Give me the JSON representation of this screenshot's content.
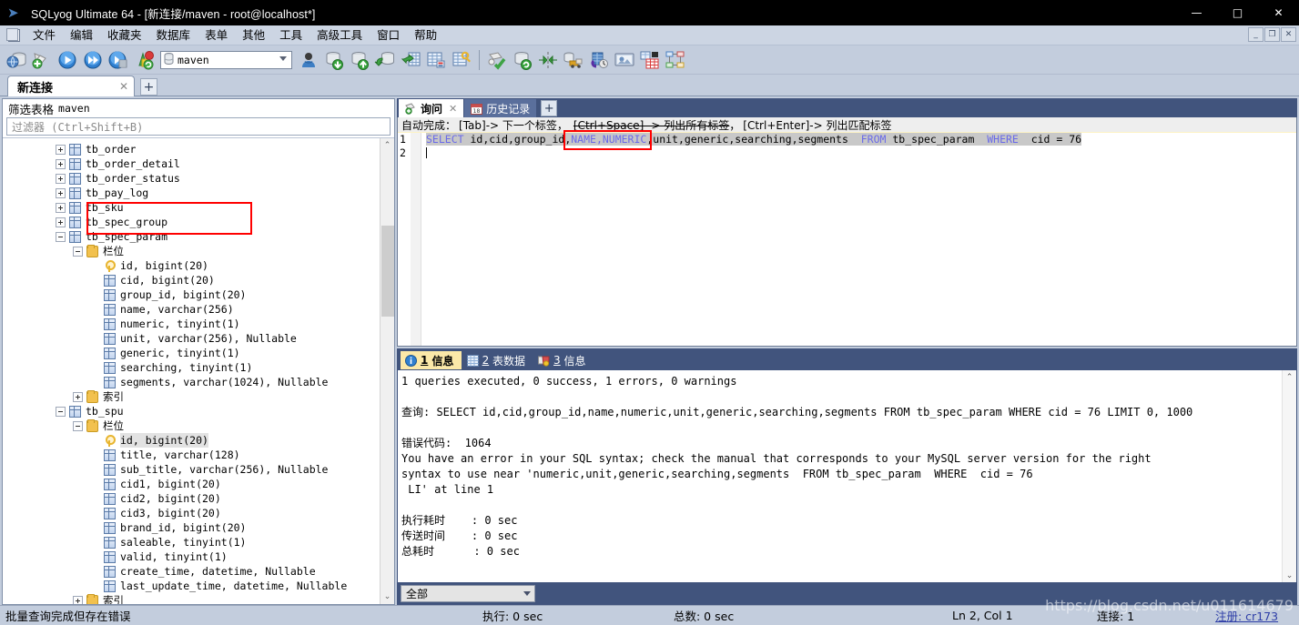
{
  "window": {
    "title": "SQLyog Ultimate 64 - [新连接/maven - root@localhost*]",
    "app_icon": "sqlyog-dolphin-icon",
    "minimize": "—",
    "maximize": "□",
    "close": "✕",
    "mdi_minimize": "_",
    "mdi_restore": "❐",
    "mdi_close": "✕"
  },
  "menu": {
    "items": [
      {
        "label": "文件"
      },
      {
        "label": "编辑"
      },
      {
        "label": "收藏夹"
      },
      {
        "label": "数据库"
      },
      {
        "label": "表单"
      },
      {
        "label": "其他"
      },
      {
        "label": "工具"
      },
      {
        "label": "高级工具"
      },
      {
        "label": "窗口"
      },
      {
        "label": "帮助"
      }
    ]
  },
  "toolbar": {
    "database_selector_value": "maven",
    "buttons": [
      {
        "name": "new-connection-icon"
      },
      {
        "name": "new-query-tab-icon"
      },
      {
        "name": "execute-query-icon"
      },
      {
        "name": "execute-all-queries-icon"
      },
      {
        "name": "stop-query-icon"
      },
      {
        "name": "refresh-objects-icon"
      },
      {
        "name": "user-manager-icon"
      },
      {
        "name": "import-database-icon"
      },
      {
        "name": "export-database-icon"
      },
      {
        "name": "backup-database-icon"
      },
      {
        "name": "restore-table-icon"
      },
      {
        "name": "create-table-icon"
      },
      {
        "name": "manage-index-icon"
      },
      {
        "name": "query-builder-icon"
      },
      {
        "name": "sync-database-icon"
      },
      {
        "name": "data-compare-icon"
      },
      {
        "name": "schema-migration-icon"
      },
      {
        "name": "scheduled-backup-icon"
      },
      {
        "name": "notifications-icon"
      },
      {
        "name": "grid-view-icon"
      },
      {
        "name": "er-diagram-icon"
      }
    ]
  },
  "connection_tabs": {
    "tabs": [
      {
        "label": "新连接",
        "close": "✕",
        "active": true
      }
    ],
    "add_label": "+"
  },
  "object_browser": {
    "filter_title": "筛选表格",
    "filter_database": "maven",
    "filter_placeholder": "过滤器 (Ctrl+Shift+B)",
    "tree": [
      {
        "indent": 1,
        "expander": "plus",
        "icon": "table-icon",
        "label": "tb_order"
      },
      {
        "indent": 1,
        "expander": "plus",
        "icon": "table-icon",
        "label": "tb_order_detail"
      },
      {
        "indent": 1,
        "expander": "plus",
        "icon": "table-icon",
        "label": "tb_order_status"
      },
      {
        "indent": 1,
        "expander": "plus",
        "icon": "table-icon",
        "label": "tb_pay_log"
      },
      {
        "indent": 1,
        "expander": "plus",
        "icon": "table-icon",
        "label": "tb_sku"
      },
      {
        "indent": 1,
        "expander": "plus",
        "icon": "table-icon",
        "label": "tb_spec_group"
      },
      {
        "indent": 1,
        "expander": "minus",
        "icon": "table-icon",
        "label": "tb_spec_param"
      },
      {
        "indent": 2,
        "expander": "minus",
        "icon": "folder-icon",
        "label": "栏位"
      },
      {
        "indent": 3,
        "expander": "none",
        "icon": "key-icon",
        "label": "id, bigint(20)"
      },
      {
        "indent": 3,
        "expander": "none",
        "icon": "column-icon",
        "label": "cid, bigint(20)"
      },
      {
        "indent": 3,
        "expander": "none",
        "icon": "column-icon",
        "label": "group_id, bigint(20)"
      },
      {
        "indent": 3,
        "expander": "none",
        "icon": "column-icon",
        "label": "name, varchar(256)"
      },
      {
        "indent": 3,
        "expander": "none",
        "icon": "column-icon",
        "label": "numeric, tinyint(1)"
      },
      {
        "indent": 3,
        "expander": "none",
        "icon": "column-icon",
        "label": "unit, varchar(256), Nullable"
      },
      {
        "indent": 3,
        "expander": "none",
        "icon": "column-icon",
        "label": "generic, tinyint(1)"
      },
      {
        "indent": 3,
        "expander": "none",
        "icon": "column-icon",
        "label": "searching, tinyint(1)"
      },
      {
        "indent": 3,
        "expander": "none",
        "icon": "column-icon",
        "label": "segments, varchar(1024), Nullable"
      },
      {
        "indent": 2,
        "expander": "plus",
        "icon": "folder-icon",
        "label": "索引"
      },
      {
        "indent": 1,
        "expander": "minus",
        "icon": "table-icon",
        "label": "tb_spu"
      },
      {
        "indent": 2,
        "expander": "minus",
        "icon": "folder-icon",
        "label": "栏位"
      },
      {
        "indent": 3,
        "expander": "none",
        "icon": "key-icon",
        "label": "id, bigint(20)",
        "selected": true
      },
      {
        "indent": 3,
        "expander": "none",
        "icon": "column-icon",
        "label": "title, varchar(128)"
      },
      {
        "indent": 3,
        "expander": "none",
        "icon": "column-icon",
        "label": "sub_title, varchar(256), Nullable"
      },
      {
        "indent": 3,
        "expander": "none",
        "icon": "column-icon",
        "label": "cid1, bigint(20)"
      },
      {
        "indent": 3,
        "expander": "none",
        "icon": "column-icon",
        "label": "cid2, bigint(20)"
      },
      {
        "indent": 3,
        "expander": "none",
        "icon": "column-icon",
        "label": "cid3, bigint(20)"
      },
      {
        "indent": 3,
        "expander": "none",
        "icon": "column-icon",
        "label": "brand_id, bigint(20)"
      },
      {
        "indent": 3,
        "expander": "none",
        "icon": "column-icon",
        "label": "saleable, tinyint(1)"
      },
      {
        "indent": 3,
        "expander": "none",
        "icon": "column-icon",
        "label": "valid, tinyint(1)"
      },
      {
        "indent": 3,
        "expander": "none",
        "icon": "column-icon",
        "label": "create_time, datetime, Nullable"
      },
      {
        "indent": 3,
        "expander": "none",
        "icon": "column-icon",
        "label": "last_update_time, datetime, Nullable"
      },
      {
        "indent": 2,
        "expander": "plus",
        "icon": "folder-icon",
        "label": "索引"
      }
    ],
    "scroll_up": "⌃",
    "scroll_down": "⌄"
  },
  "query": {
    "tabs": [
      {
        "label": "询问",
        "icon": "query-tab-icon",
        "close": "✕",
        "active": true
      },
      {
        "label": "历史记录",
        "icon": "history-tab-icon",
        "active": false
      }
    ],
    "add_tab_label": "+",
    "autocomplete_hint_1": "自动完成：",
    "autocomplete_hint_2": "[Tab]-> 下一个标签，",
    "autocomplete_hint_strike": "[Ctrl+Space] -> 列出所有标签",
    "autocomplete_hint_3": "，",
    "autocomplete_hint_4": "[Ctrl+Enter]-> 列出匹配标签",
    "line_numbers": [
      "1",
      "2"
    ],
    "sql_part_1": "SELECT",
    "sql_part_2": " id,cid,group_id,",
    "sql_part_3": "NAME,NUMERIC",
    "sql_part_4": ",unit,generic,searching,segments  ",
    "sql_part_5": "FROM",
    "sql_part_6": " tb_spec_param  ",
    "sql_part_7": "WHERE",
    "sql_part_8": "  cid = 76"
  },
  "results": {
    "tabs": [
      {
        "num": "1",
        "label": "信息",
        "icon": "info-icon",
        "active": true
      },
      {
        "num": "2",
        "label": "表数据",
        "icon": "grid-icon",
        "active": false
      },
      {
        "num": "3",
        "label": "信息",
        "icon": "message-icon",
        "active": false
      }
    ],
    "output": "1 queries executed, 0 success, 1 errors, 0 warnings\n\n查询: SELECT id,cid,group_id,name,numeric,unit,generic,searching,segments FROM tb_spec_param WHERE cid = 76 LIMIT 0, 1000\n\n错误代码:  1064\nYou have an error in your SQL syntax; check the manual that corresponds to your MySQL server version for the right\nsyntax to use near 'numeric,unit,generic,searching,segments  FROM tb_spec_param  WHERE  cid = 76\n LI' at line 1\n\n执行耗时    : 0 sec\n传送时间    : 0 sec\n总耗时      : 0 sec",
    "filter_select_value": "全部",
    "scroll_up": "⌃",
    "scroll_down": "⌄"
  },
  "statusbar": {
    "message": "批量查询完成但存在错误",
    "exec_label": "执行: 0 sec",
    "total_label": "总数: 0 sec",
    "cursor": "Ln 2, Col 1",
    "connections": "连接: 1",
    "register": "注册: cr173"
  },
  "watermark": "https://blog.csdn.net/u011614679",
  "colors": {
    "titlebar_bg": "#000000",
    "window_bg": "#c3cddd",
    "panel_header_bg": "#41547d",
    "active_tab_bg": "#fbe8a8",
    "keyword": "#6a6ae8",
    "highlight_box": "#ff0000",
    "selection": "#c8c8c8"
  }
}
